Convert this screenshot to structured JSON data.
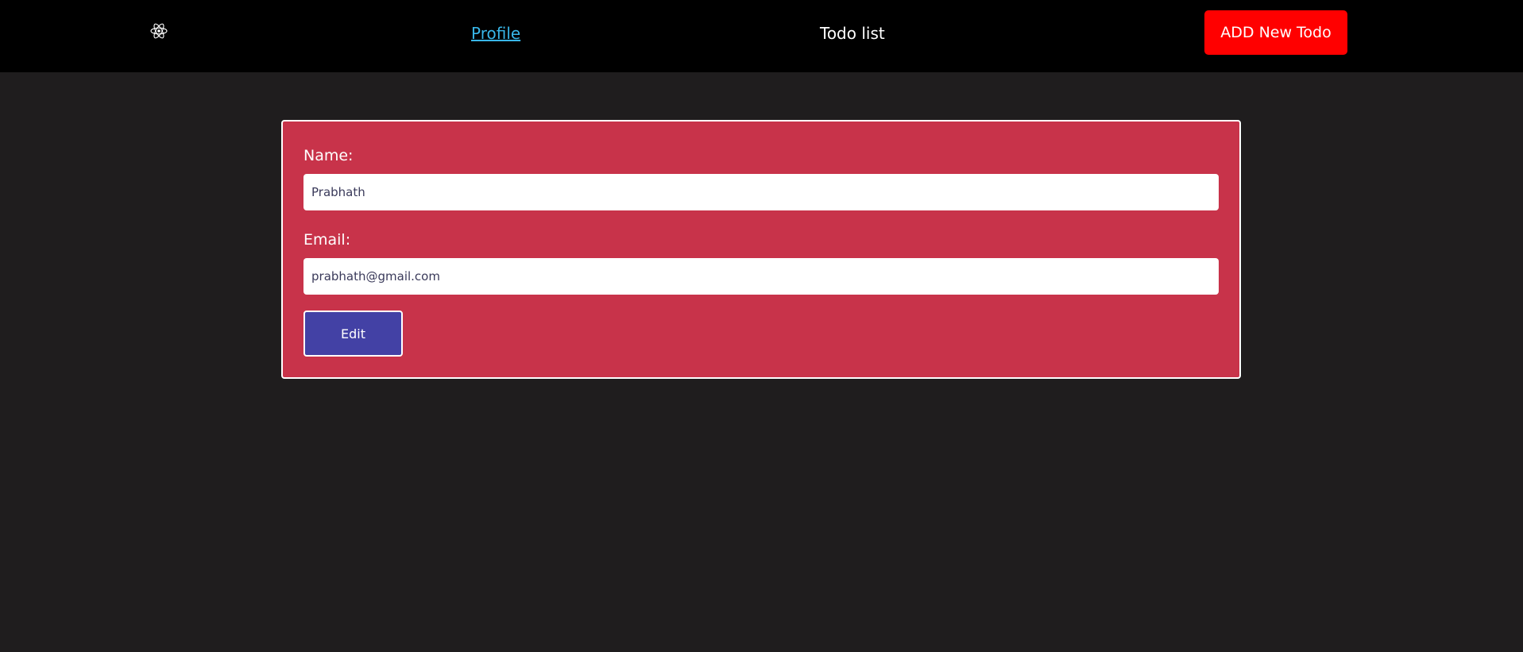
{
  "navbar": {
    "logo_icon": "react-atom-icon",
    "links": [
      {
        "label": "Profile",
        "active": true
      },
      {
        "label": "Todo list",
        "active": false
      }
    ],
    "add_button_label": "ADD New Todo"
  },
  "profile_form": {
    "name_label": "Name:",
    "name_value": "Prabhath",
    "email_label": "Email:",
    "email_value": "prabhath@gmail.com",
    "edit_button_label": "Edit"
  },
  "colors": {
    "navbar_bg": "#000000",
    "page_bg": "#1f1d1e",
    "card_bg": "#c8334a",
    "add_button_bg": "#ff0000",
    "edit_button_bg": "#4341a5",
    "active_link": "#38b6e8"
  }
}
